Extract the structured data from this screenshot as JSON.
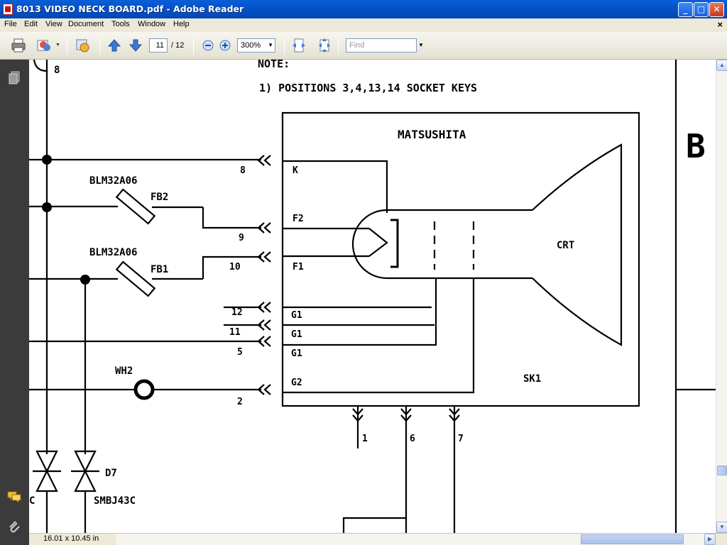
{
  "window": {
    "title": "8013  VIDEO NECK BOARD.pdf - Adobe Reader",
    "minimize": "_",
    "maximize": "□",
    "close": "✕"
  },
  "menu": {
    "items": [
      "File",
      "Edit",
      "View",
      "Document",
      "Tools",
      "Window",
      "Help"
    ],
    "close_x": "×"
  },
  "toolbar": {
    "current_page": "11",
    "total_pages": "/ 12",
    "zoom": "300%",
    "find_placeholder": "Find",
    "icons": [
      "print-icon",
      "collaborate-icon",
      "security-icon",
      "previous-page-icon",
      "next-page-icon",
      "zoom-out-icon",
      "zoom-in-icon",
      "fit-width-icon",
      "fit-page-icon"
    ]
  },
  "nav_panel": {
    "icons": [
      "pages-icon",
      "comments-icon",
      "attachments-icon"
    ]
  },
  "status": {
    "page_size": "16.01 x 10.45 in"
  },
  "document": {
    "note_title": "NOTE:",
    "note_line": "1)  POSITIONS  3,4,13,14  SOCKET  KEYS",
    "manufacturer": "MATSUSHITA",
    "crt_label": "CRT",
    "socket_label": "SK1",
    "ferrite_part_1": "BLM32A06",
    "ferrite_ref_1": "FB2",
    "ferrite_part_2": "BLM32A06",
    "ferrite_ref_2": "FB1",
    "wire_label": "WH2",
    "diode_ref": "D7",
    "diode_part": "SMBJ43C",
    "diode_left_partial": "C",
    "top_partial_number": "8",
    "right_partial": "B",
    "pin_labels": [
      "K",
      "F2",
      "F1",
      "G1",
      "G1",
      "G1",
      "G2"
    ],
    "pin_numbers_left": [
      "8",
      "9",
      "10",
      "12",
      "11",
      "5",
      "2"
    ],
    "pin_numbers_bottom": [
      "1",
      "6",
      "7"
    ]
  }
}
